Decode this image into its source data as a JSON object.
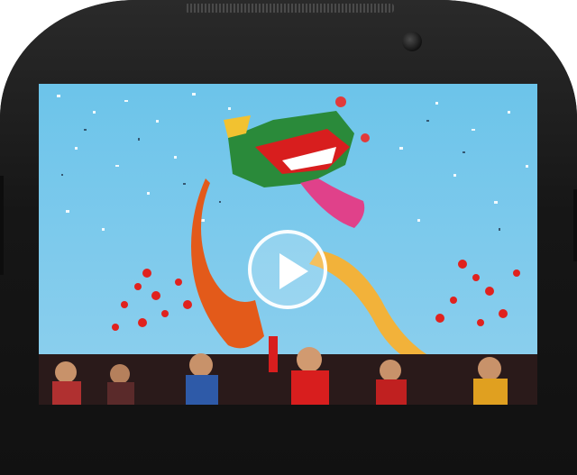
{
  "device": {
    "frame_color": "#1b1b1b",
    "model": ""
  },
  "video": {
    "thumbnail_icon": "dragon-dance-photo",
    "play_icon": "play-icon",
    "sky_color": "#5bb7e3",
    "accent_red": "#d81e1e"
  }
}
